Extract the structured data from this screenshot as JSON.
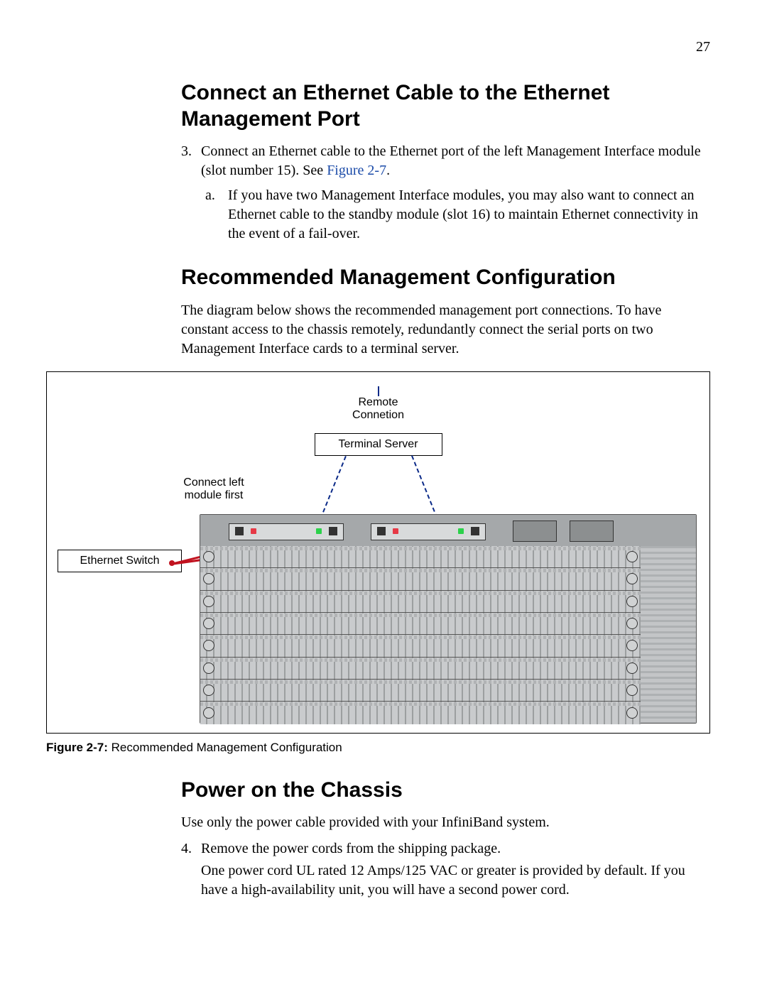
{
  "page_number": "27",
  "headings": {
    "connect_eth": "Connect an Ethernet Cable to the Ethernet Management Port",
    "recommended": "Recommended Management Configuration",
    "power_on": "Power on the Chassis"
  },
  "steps": {
    "s3_num": "3.",
    "s3_text_a": "Connect an Ethernet cable to the Ethernet port of the left Management Interface module (slot number 15). See ",
    "s3_figref": "Figure 2-7",
    "s3_text_b": ".",
    "s3a_letter": "a.",
    "s3a_text": "If you have two Management Interface modules, you may also want to connect an Ethernet cable to the standby module (slot 16) to maintain Ethernet connectivity in the event of a fail-over.",
    "recommended_para": "The diagram below shows the recommended management port connections. To have constant access to the chassis remotely, redundantly connect the serial ports on two Management Interface cards to a terminal server.",
    "power_para": "Use only the power cable provided with your InfiniBand system.",
    "s4_num": "4.",
    "s4_text": "Remove the power cords from the shipping package.",
    "s4_cont": "One power cord UL rated 12 Amps/125 VAC or greater is provided by default. If you have a high-availability unit, you will have a second power cord."
  },
  "figure": {
    "label": "Figure 2-7:",
    "caption": "Recommended Management Configuration",
    "remote_connection": "Remote\nConnetion",
    "terminal_server": "Terminal Server",
    "connect_left": "Connect left\nmodule first",
    "ethernet_switch": "Ethernet Switch"
  }
}
